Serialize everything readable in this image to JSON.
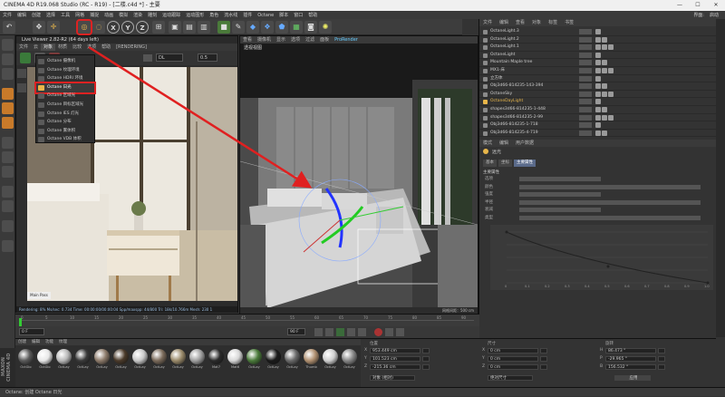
{
  "window": {
    "title": "CINEMA 4D R19.068 Studio (RC - R19) - [二楼.c4d *] - 主要",
    "minimize": "—",
    "maximize": "☐",
    "close": "✕"
  },
  "menubar": {
    "items": [
      "文件",
      "编辑",
      "创建",
      "选择",
      "工具",
      "网格",
      "捕捉",
      "动画",
      "模拟",
      "渲染",
      "雕刻",
      "运动跟踪",
      "运动图形",
      "角色",
      "流水线",
      "插件",
      "Octane",
      "脚本",
      "窗口",
      "帮助"
    ],
    "right": [
      "界面:",
      "启动"
    ]
  },
  "toolbar": {
    "axis_labels": [
      "X",
      "Y",
      "Z"
    ]
  },
  "live_viewer": {
    "title": "Live Viewer 2.82-R2 (64 days left)",
    "tabs": [
      "文件",
      "云",
      "对象",
      "材质",
      "比较",
      "选项",
      "帮助",
      "[RENDERING]"
    ],
    "channel": "DL",
    "channel_value": "0.5",
    "status": "Rendering: 8%  Ms/sec: 0.734   Time: 00:00:00/00:00:04   Spp/maxspp: 44/800   Tri: 18k/10.766m   Mesh: 230 1"
  },
  "octane_menu": {
    "items": [
      {
        "label": "Octane 摄像机",
        "selected": false
      },
      {
        "label": "Octane 纹理环境",
        "selected": false
      },
      {
        "label": "Octane HDRI 环境",
        "selected": false
      },
      {
        "label": "Octane 日光",
        "selected": true
      },
      {
        "label": "Octane 区域光",
        "selected": false
      },
      {
        "label": "Octane 目标区域光",
        "selected": false
      },
      {
        "label": "Octane IES 灯光",
        "selected": false
      },
      {
        "label": "Octane 分布",
        "selected": false
      },
      {
        "label": "Octane 雾体积",
        "selected": false
      },
      {
        "label": "Octane VDB 体积",
        "selected": false
      }
    ]
  },
  "viewport": {
    "menu": [
      "查看",
      "摄像机",
      "显示",
      "选项",
      "过滤",
      "面板",
      "ProRender"
    ],
    "label": "透视视图",
    "grid_spacing": "网格间距：500 cm"
  },
  "object_manager": {
    "tabs": [
      "文件",
      "编辑",
      "查看",
      "对象",
      "标签",
      "书签"
    ],
    "rows": [
      {
        "name": "OctaneLight.3",
        "selected": false
      },
      {
        "name": "OctaneLight.2",
        "selected": false
      },
      {
        "name": "OctaneLight.1",
        "selected": false
      },
      {
        "name": "OctaneLight",
        "selected": false
      },
      {
        "name": "Mountain Maple tree",
        "selected": false
      },
      {
        "name": "MX1-床",
        "selected": false
      },
      {
        "name": "立方体",
        "selected": false
      },
      {
        "name": "Obj3d66-814235-143-394",
        "selected": false
      },
      {
        "name": "OctaneSky",
        "selected": false
      },
      {
        "name": "OctaneDayLight",
        "selected": true
      },
      {
        "name": "shapes3d66-814235-1-448",
        "selected": false
      },
      {
        "name": "shapes3d66-814235-2-99",
        "selected": false
      },
      {
        "name": "Obj3d66-814235-1-718",
        "selected": false
      },
      {
        "name": "Obj3d66-814235-4-719",
        "selected": false
      }
    ]
  },
  "attributes": {
    "tabs": [
      "模式",
      "编辑",
      "用户数据"
    ],
    "object": "远光",
    "subtabs": [
      "基本",
      "坐标",
      "主要属性"
    ],
    "section": "主要属性",
    "params": [
      "选项",
      "颜色",
      "强度",
      "半径",
      "衰减",
      "类型"
    ],
    "curve_ticks": [
      "0",
      "0.1",
      "0.2",
      "0.3",
      "0.4",
      "0.5",
      "0.6",
      "0.7",
      "0.8",
      "0.9",
      "1.0"
    ]
  },
  "timeline": {
    "ticks": [
      "0",
      "5",
      "10",
      "15",
      "20",
      "25",
      "30",
      "35",
      "40",
      "45",
      "50",
      "55",
      "60",
      "65",
      "70",
      "75",
      "80",
      "85",
      "90"
    ],
    "current": "0 F",
    "end": "90 F"
  },
  "materials": {
    "tabs": [
      "创建",
      "编辑",
      "功能",
      "纹理"
    ],
    "items": [
      "OctGlo",
      "OctGlo",
      "OctLay",
      "OctLay",
      "OctLay",
      "OctLay",
      "OctLay",
      "OctLay",
      "OctLay",
      "OctLay",
      "Mat7",
      "Mat6",
      "OctLay",
      "OctLay",
      "OctLay",
      "Thumb",
      "OctLay",
      "OctLay"
    ],
    "colors": [
      "#5a5a5a",
      "#e8e8e8",
      "#b8b8b8",
      "#3a3a3a",
      "#8c7a6a",
      "#4a3a2a",
      "#c8c8c8",
      "#7a6a5a",
      "#9a8a6a",
      "#a0a0a0",
      "#2a2a2a",
      "#d8d8d8",
      "#4a7a3a",
      "#1a1a1a",
      "#6a6a6a",
      "#b09070",
      "#d0d0d0",
      "#888888"
    ]
  },
  "coords": {
    "headers": [
      "位置",
      "尺寸",
      "旋转"
    ],
    "pos": [
      "953.449 cm",
      "101.523 cm",
      "-215.36 cm"
    ],
    "size": [
      "0 cm",
      "0 cm",
      "0 cm"
    ],
    "rot": [
      "86.473 °",
      "-29.965 °",
      "156.532 °"
    ],
    "axis": [
      "X",
      "Y",
      "Z"
    ],
    "size_axis": [
      "X",
      "Y",
      "Z"
    ],
    "rot_axis": [
      "H",
      "P",
      "B"
    ],
    "mode_a": "对象 (相对)",
    "mode_b": "绝对尺寸",
    "apply": "应用"
  },
  "statusbar": {
    "text": "Octane: 创建 Octane 日光"
  },
  "brand": {
    "logo": "MAXON CINEMA 4D"
  }
}
